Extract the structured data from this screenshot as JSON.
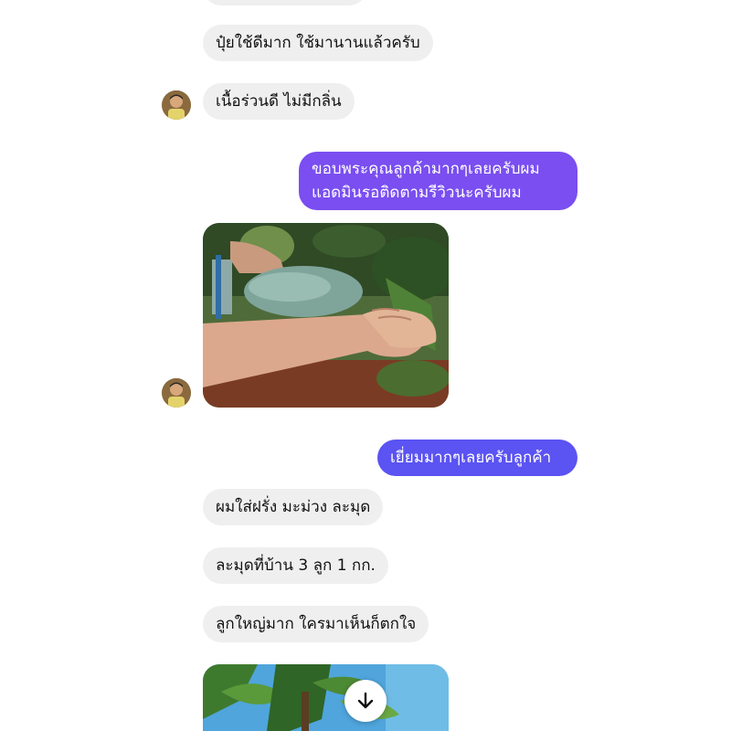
{
  "messages": [
    {
      "text": "ปุ๋ยใช้ดีมาก ใช้มานานแล้วครับ"
    },
    {
      "text": "เนื้อร่วนดี ไม่มีกลิ่น"
    },
    {
      "line1": "ขอบพระคุณลูกค้ามากๆเลยครับผม",
      "line2": "แอดมินรอติดตามรีวิวนะครับผม"
    },
    {
      "text": "เยี่ยมมากๆเลยครับลูกค้า"
    },
    {
      "text": "ผมใส่ฝรั่ง มะม่วง ละมุด"
    },
    {
      "text": "ละมุดที่บ้าน 3 ลูก 1 กก."
    },
    {
      "text": "ลูกใหญ่มาก ใครมาเห็นก็ตกใจ"
    }
  ],
  "icons": {
    "scroll_down": "arrow-down-icon",
    "avatar": "user-avatar"
  },
  "colors": {
    "incoming_bubble": "#efefef",
    "outgoing_violet": "#7a4ef0",
    "outgoing_blue": "#5b53f2"
  }
}
